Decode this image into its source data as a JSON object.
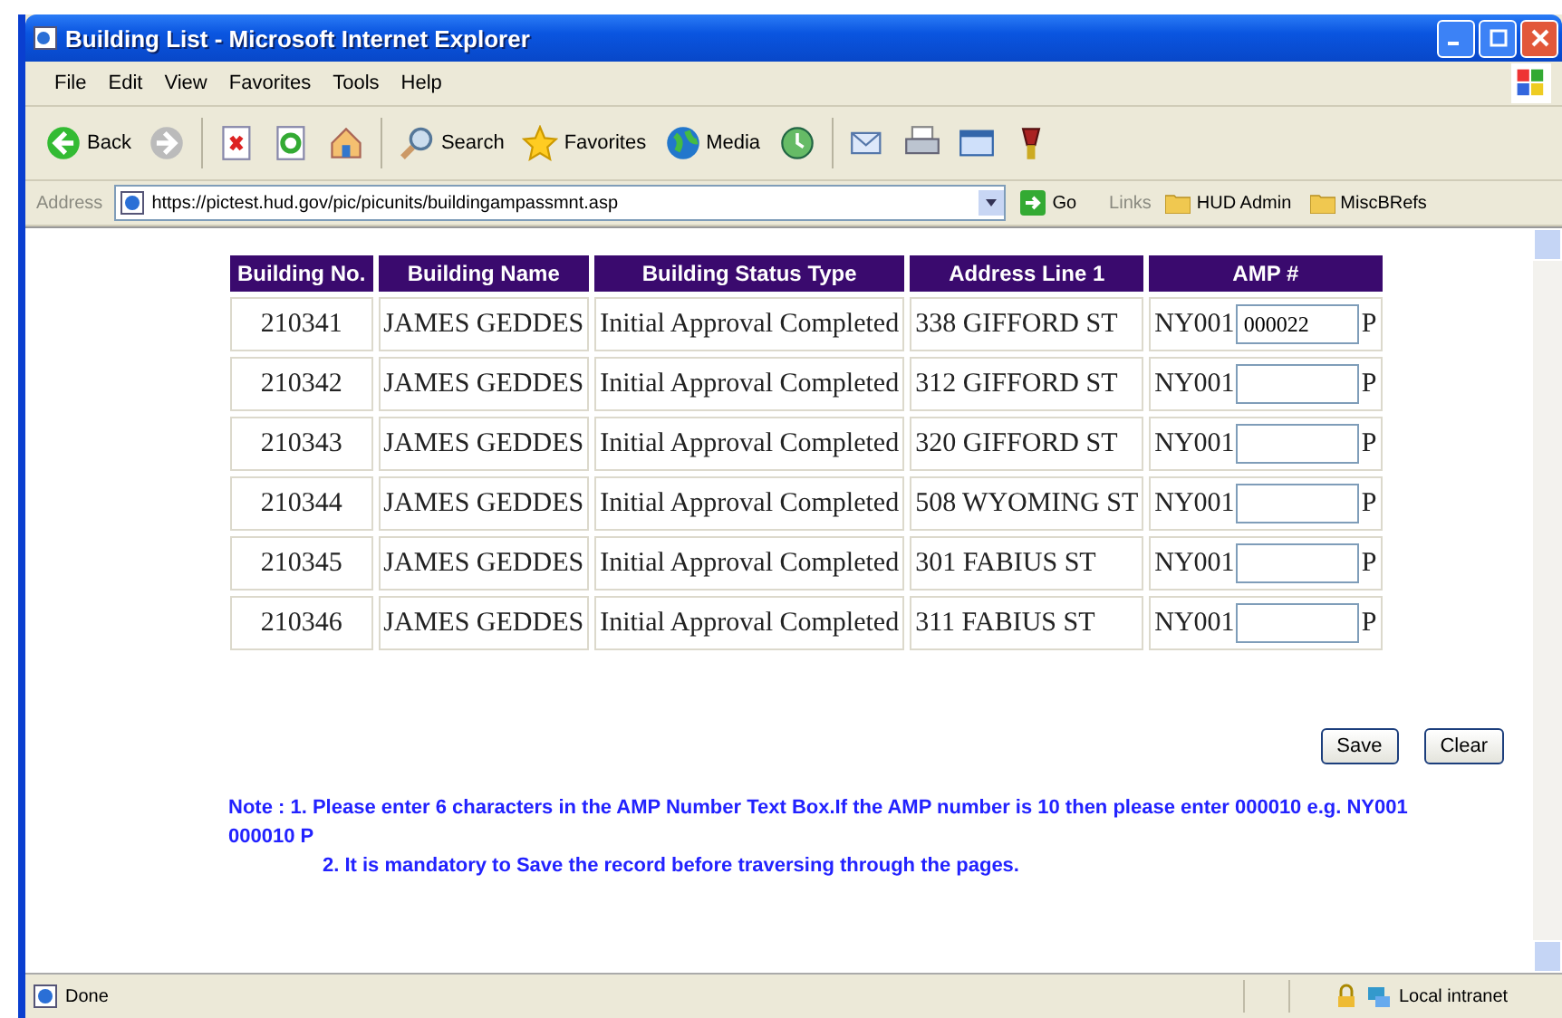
{
  "window": {
    "title": "Building List - Microsoft Internet Explorer"
  },
  "menu": [
    "File",
    "Edit",
    "View",
    "Favorites",
    "Tools",
    "Help"
  ],
  "toolbar": [
    {
      "kind": "back",
      "label": "Back"
    },
    {
      "kind": "forward"
    },
    {
      "kind": "stop"
    },
    {
      "kind": "refresh"
    },
    {
      "kind": "home"
    },
    {
      "kind": "search",
      "label": "Search"
    },
    {
      "kind": "favorites",
      "label": "Favorites"
    },
    {
      "kind": "media",
      "label": "Media"
    },
    {
      "kind": "history"
    },
    {
      "kind": "mail"
    },
    {
      "kind": "print"
    },
    {
      "kind": "edit"
    },
    {
      "kind": "extra"
    }
  ],
  "address": {
    "label": "Address",
    "url": "https://pictest.hud.gov/pic/picunits/buildingampassmnt.asp",
    "go": "Go",
    "links_label": "Links",
    "links": [
      "HUD Admin",
      "MiscBRefs"
    ]
  },
  "table": {
    "columns": [
      "Building No.",
      "Building Name",
      "Building Status Type",
      "Address Line 1",
      "AMP #"
    ],
    "rows": [
      {
        "number": "210341",
        "name": "JAMES GEDDES",
        "status": "Initial Approval Completed",
        "address": "338 GIFFORD ST",
        "amp_prefix": "NY001",
        "amp_value": "000022",
        "amp_suffix": "P"
      },
      {
        "number": "210342",
        "name": "JAMES GEDDES",
        "status": "Initial Approval Completed",
        "address": "312 GIFFORD ST",
        "amp_prefix": "NY001",
        "amp_suffix": "P"
      },
      {
        "number": "210343",
        "name": "JAMES GEDDES",
        "status": "Initial Approval Completed",
        "address": "320 GIFFORD ST",
        "amp_prefix": "NY001",
        "amp_suffix": "P"
      },
      {
        "number": "210344",
        "name": "JAMES GEDDES",
        "status": "Initial Approval Completed",
        "address": "508 WYOMING ST",
        "amp_prefix": "NY001",
        "amp_suffix": "P"
      },
      {
        "number": "210345",
        "name": "JAMES GEDDES",
        "status": "Initial Approval Completed",
        "address": "301 FABIUS ST",
        "amp_prefix": "NY001",
        "amp_suffix": "P"
      },
      {
        "number": "210346",
        "name": "JAMES GEDDES",
        "status": "Initial Approval Completed",
        "address": "311 FABIUS ST",
        "amp_prefix": "NY001",
        "amp_suffix": "P"
      }
    ]
  },
  "buttons": [
    "Save",
    "Clear"
  ],
  "notes": [
    "Note : 1. Please enter 6 characters in the AMP Number Text Box.If the AMP number is 10 then please enter 000010 e.g. NY001 000010 P",
    "2. It is mandatory to Save the record before traversing through the pages."
  ],
  "status_bar": {
    "text": "Done",
    "zone": "Local intranet"
  }
}
